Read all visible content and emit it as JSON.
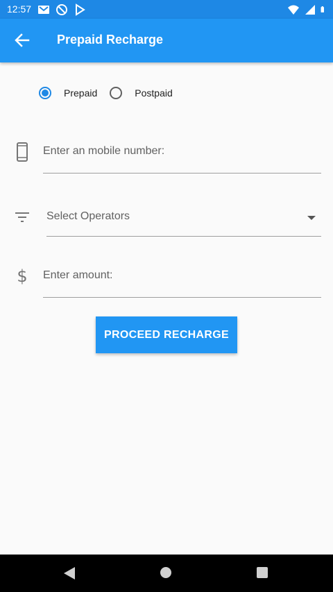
{
  "status_bar": {
    "time": "12:57",
    "left_icons": [
      "gmail-icon",
      "do-not-disturb-icon",
      "play-store-icon"
    ],
    "right_icons": [
      "wifi-icon",
      "signal-icon",
      "battery-icon"
    ]
  },
  "app_bar": {
    "title": "Prepaid Recharge",
    "back_icon": "arrow-back-icon",
    "background_color": "#2196f3"
  },
  "plan_type": {
    "options": [
      {
        "label": "Prepaid",
        "selected": true
      },
      {
        "label": "Postpaid",
        "selected": false
      }
    ],
    "accent_color": "#1e88e5"
  },
  "form": {
    "mobile_placeholder": "Enter an mobile number:",
    "operator_placeholder": "Select Operators",
    "amount_placeholder": "Enter amount:"
  },
  "actions": {
    "proceed_label": "PROCEED RECHARGE",
    "button_color": "#2196f3"
  },
  "nav_bar": {
    "icons": [
      "nav-back-icon",
      "nav-home-icon",
      "nav-recents-icon"
    ]
  }
}
